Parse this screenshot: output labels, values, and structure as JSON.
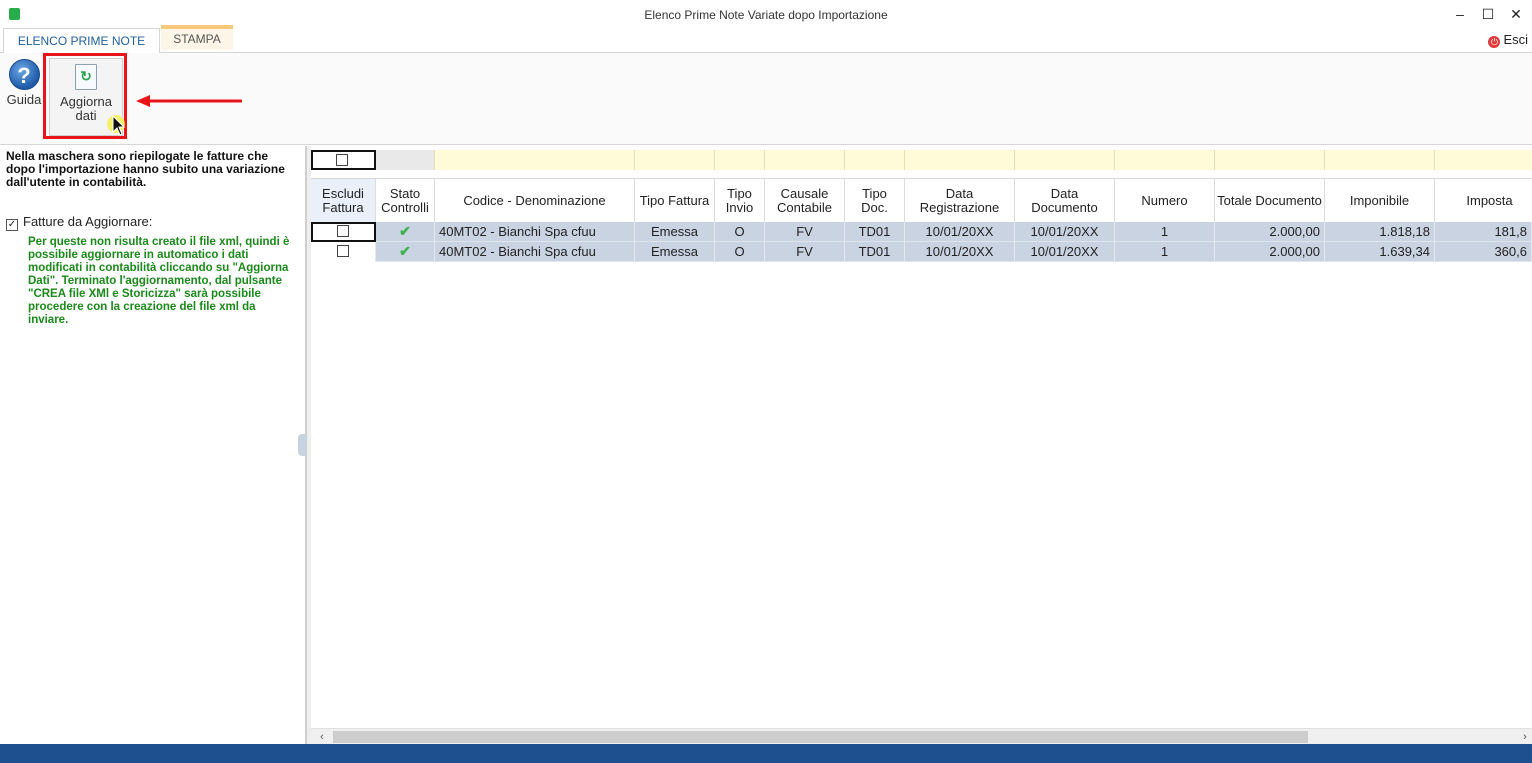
{
  "window": {
    "title": "Elenco Prime Note Variate dopo Importazione",
    "minimize": "–",
    "maximize": "☐",
    "close": "✕"
  },
  "tabs": {
    "active": "ELENCO PRIME NOTE",
    "stampa": "STAMPA",
    "esci": "Esci"
  },
  "ribbon": {
    "guida_label": "Guida",
    "aggiorna_line1": "Aggiorna",
    "aggiorna_line2": "dati"
  },
  "left_panel": {
    "intro": "Nella maschera sono riepilogate le fatture che dopo l'importazione hanno subito una variazione dall'utente in contabilità.",
    "checkbox_label": "Fatture da Aggiornare:",
    "checkbox_checked": true,
    "note": "Per queste non risulta creato il file xml, quindi è possibile aggiornare in automatico i dati modificati in contabilità cliccando su \"Aggiorna Dati\". Terminato l'aggiornamento, dal pulsante \"CREA file XMl e Storicizza\" sarà possibile procedere con la creazione del file xml da inviare."
  },
  "table": {
    "headers": {
      "escludi": "Escludi Fattura",
      "stato": "Stato Controlli",
      "codice": "Codice - Denominazione",
      "tipo_fattura": "Tipo Fattura",
      "tipo_invio": "Tipo Invio",
      "causale": "Causale Contabile",
      "tipo_doc": "Tipo Doc.",
      "data_reg": "Data Registrazione",
      "data_doc": "Data Documento",
      "numero": "Numero",
      "totale": "Totale Documento",
      "imponibile": "Imponibile",
      "imposta": "Imposta"
    },
    "rows": [
      {
        "stato": "✔",
        "codice": "40MT02 - Bianchi Spa cfuu",
        "tipo_fattura": "Emessa",
        "tipo_invio": "O",
        "causale": "FV",
        "tipo_doc": "TD01",
        "data_reg": "10/01/20XX",
        "data_doc": "10/01/20XX",
        "numero": "1",
        "totale": "2.000,00",
        "imponibile": "1.818,18",
        "imposta": "181,8"
      },
      {
        "stato": "✔",
        "codice": "40MT02 - Bianchi Spa cfuu",
        "tipo_fattura": "Emessa",
        "tipo_invio": "O",
        "causale": "FV",
        "tipo_doc": "TD01",
        "data_reg": "10/01/20XX",
        "data_doc": "10/01/20XX",
        "numero": "1",
        "totale": "2.000,00",
        "imponibile": "1.639,34",
        "imposta": "360,6"
      }
    ]
  },
  "colors": {
    "accent": "#1f5fa0",
    "highlight": "#e8141a",
    "note_green": "#1a8a1a",
    "row_selected": "#c9d3e2",
    "filter_yellow": "#fffbd8",
    "statusbar": "#1e4f8f"
  },
  "icons": {
    "guida": "help-question-icon",
    "aggiorna": "refresh-document-icon",
    "esci": "exit-icon",
    "stato": "check-icon"
  }
}
